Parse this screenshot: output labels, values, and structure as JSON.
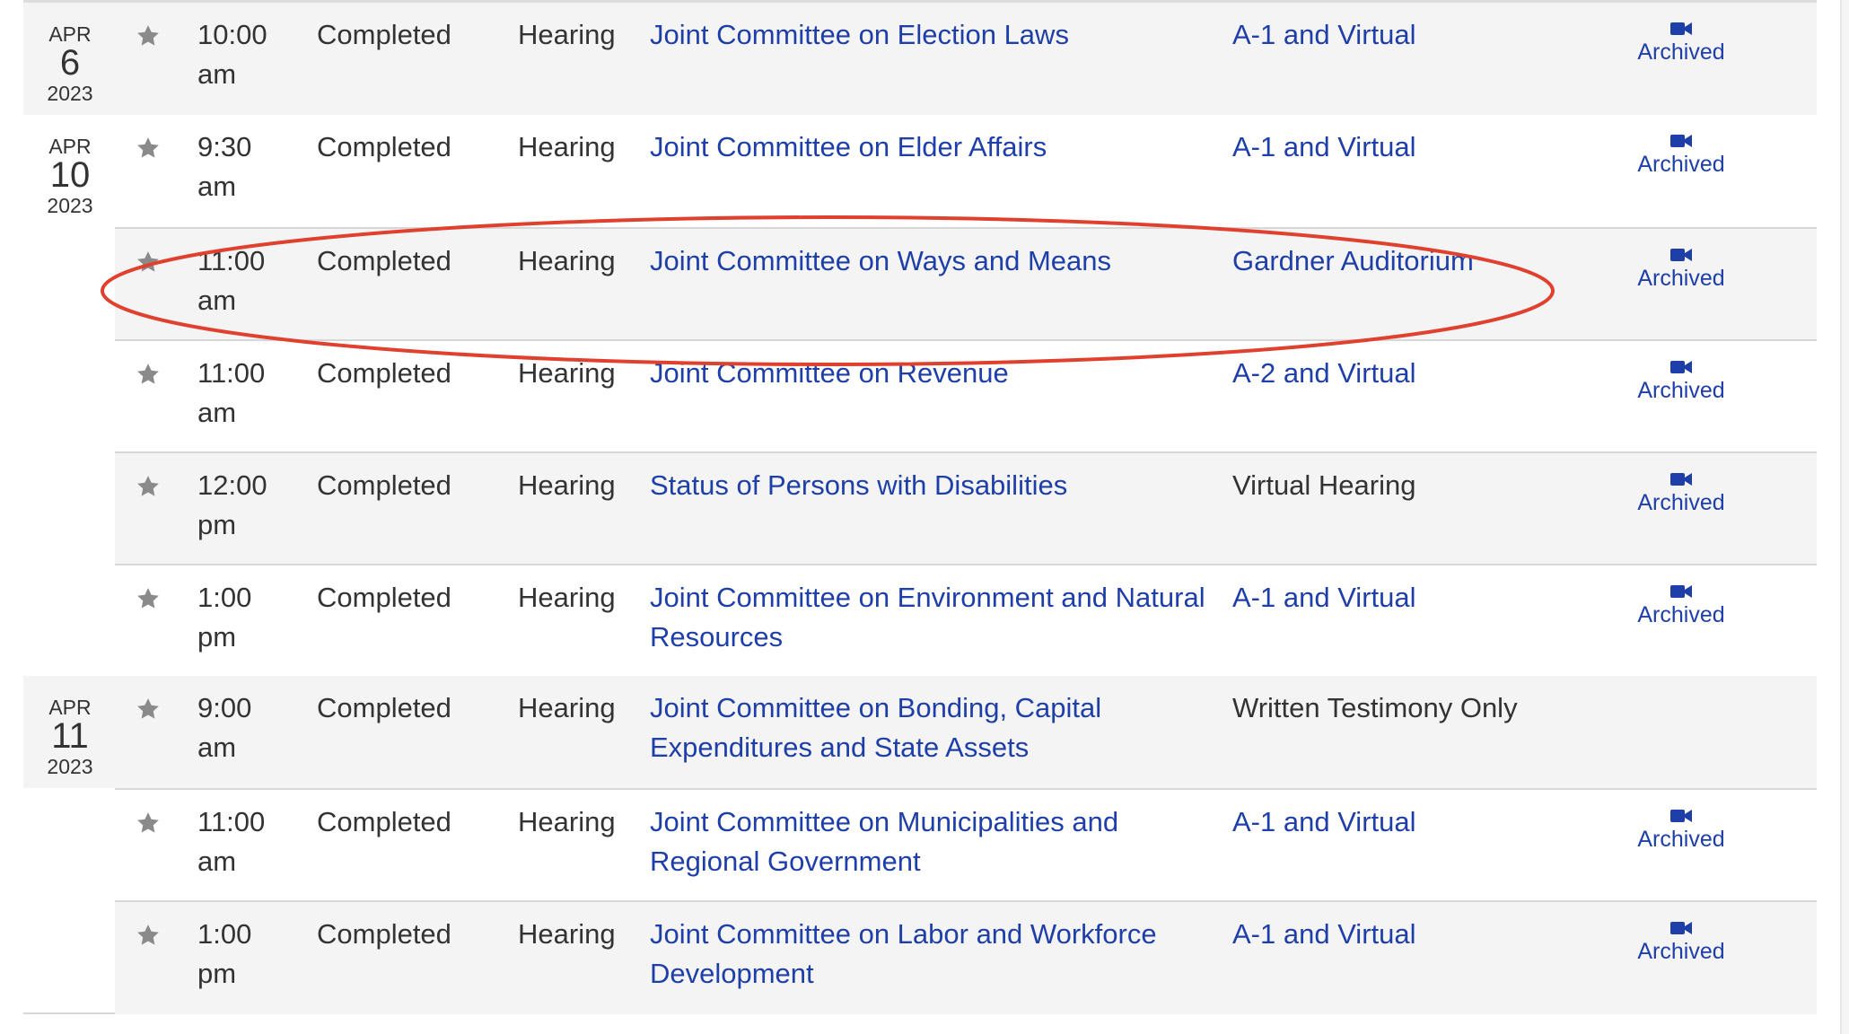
{
  "colors": {
    "link": "#1f3fa8",
    "text": "#333333",
    "row_shade": "#f4f4f4",
    "star": "#8a8a8a",
    "highlight": "#e0412f"
  },
  "icons": {
    "favorite": "star-icon",
    "video": "video-camera-icon"
  },
  "days": [
    {
      "month": "APR",
      "day": "6",
      "year": "2023",
      "events": [
        {
          "time": "10:00 am",
          "status": "Completed",
          "type": "Hearing",
          "committee": "Joint Committee on Election Laws",
          "location": "A-1 and Virtual",
          "location_link": true,
          "archived": "Archived"
        }
      ]
    },
    {
      "month": "APR",
      "day": "10",
      "year": "2023",
      "events": [
        {
          "time": "9:30 am",
          "status": "Completed",
          "type": "Hearing",
          "committee": "Joint Committee on Elder Affairs",
          "location": "A-1 and Virtual",
          "location_link": true,
          "archived": "Archived"
        },
        {
          "time": "11:00 am",
          "status": "Completed",
          "type": "Hearing",
          "committee": "Joint Committee on Ways and Means",
          "location": "Gardner Auditorium",
          "location_link": true,
          "archived": "Archived",
          "highlighted": true
        },
        {
          "time": "11:00 am",
          "status": "Completed",
          "type": "Hearing",
          "committee": "Joint Committee on Revenue",
          "location": "A-2 and Virtual",
          "location_link": true,
          "archived": "Archived"
        },
        {
          "time": "12:00 pm",
          "status": "Completed",
          "type": "Hearing",
          "committee": "Status of Persons with Disabilities",
          "location": "Virtual Hearing",
          "location_link": false,
          "archived": "Archived"
        },
        {
          "time": "1:00 pm",
          "status": "Completed",
          "type": "Hearing",
          "committee": "Joint Committee on Environment and Natural Resources",
          "location": "A-1 and Virtual",
          "location_link": true,
          "archived": "Archived"
        }
      ]
    },
    {
      "month": "APR",
      "day": "11",
      "year": "2023",
      "events": [
        {
          "time": "9:00 am",
          "status": "Completed",
          "type": "Hearing",
          "committee": "Joint Committee on Bonding, Capital Expenditures and State Assets",
          "location": "Written Testimony Only",
          "location_link": false,
          "archived": ""
        },
        {
          "time": "11:00 am",
          "status": "Completed",
          "type": "Hearing",
          "committee": "Joint Committee on Municipalities and Regional Government",
          "location": "A-1 and Virtual",
          "location_link": true,
          "archived": "Archived"
        },
        {
          "time": "1:00 pm",
          "status": "Completed",
          "type": "Hearing",
          "committee": "Joint Committee on Labor and Workforce Development",
          "location": "A-1 and Virtual",
          "location_link": true,
          "archived": "Archived"
        }
      ]
    }
  ]
}
